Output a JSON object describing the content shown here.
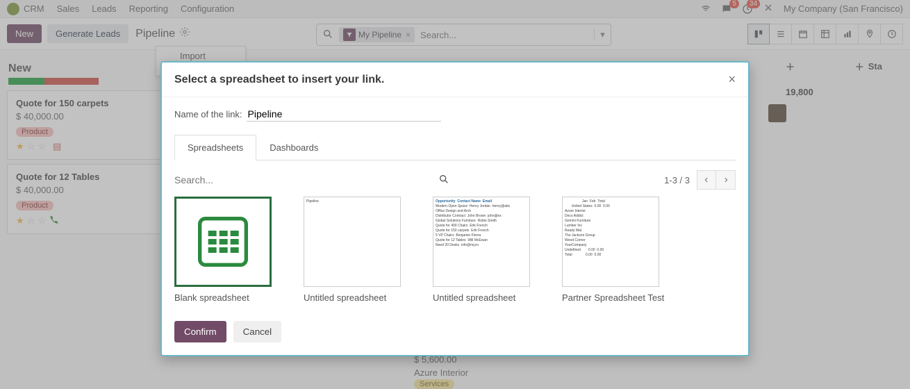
{
  "topnav": {
    "app": "CRM",
    "menu": [
      "Sales",
      "Leads",
      "Reporting",
      "Configuration"
    ],
    "msg_badge": "5",
    "clock_badge": "34",
    "company": "My Company (San Francisco)"
  },
  "controlbar": {
    "new_btn": "New",
    "gen_btn": "Generate Leads",
    "breadcrumb": "Pipeline",
    "search_chip": "My Pipeline",
    "search_placeholder": "Search..."
  },
  "import_dropdown": "Import records",
  "kanban": {
    "col1_title": "New",
    "card1": {
      "title": "Quote for 150 carpets",
      "amount": "$ 40,000.00",
      "tag": "Product"
    },
    "card2": {
      "title": "Quote for 12 Tables",
      "amount": "$ 40,000.00",
      "tag": "Product"
    },
    "right_amount": "19,800",
    "add_stage": "Sta",
    "peek_amount": "$ 5,600.00",
    "peek_customer": "Azure Interior",
    "peek_tag": "Services"
  },
  "modal": {
    "title": "Select a spreadsheet to insert your link.",
    "linkname_label": "Name of the link:",
    "linkname_value": "Pipeline",
    "tab_spreadsheets": "Spreadsheets",
    "tab_dashboards": "Dashboards",
    "search_placeholder": "Search...",
    "pager": "1-3 / 3",
    "sheets": [
      {
        "name": "Blank spreadsheet"
      },
      {
        "name": "Untitled spreadsheet"
      },
      {
        "name": "Untitled spreadsheet"
      },
      {
        "name": "Partner Spreadsheet Test"
      }
    ],
    "confirm": "Confirm",
    "cancel": "Cancel"
  }
}
